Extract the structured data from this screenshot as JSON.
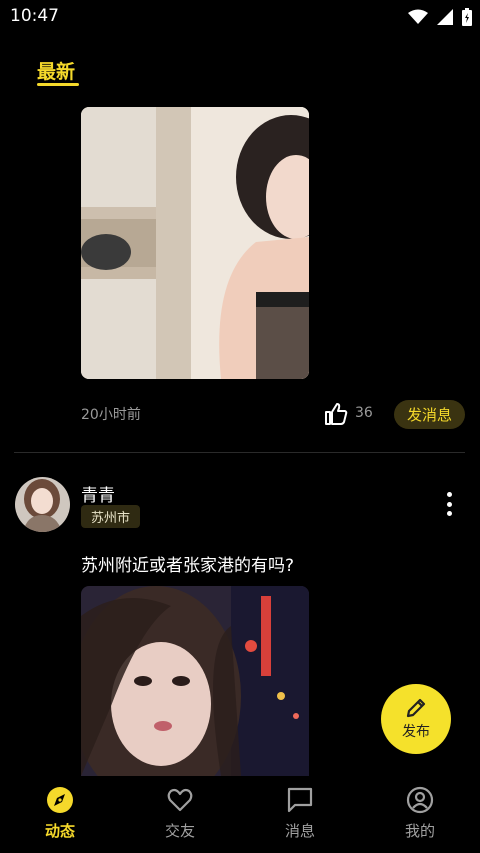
{
  "status_bar": {
    "time": "10:47"
  },
  "tabs": {
    "latest": "最新"
  },
  "post1": {
    "time_ago": "20小时前",
    "like_count": "36",
    "message_button": "发消息"
  },
  "post2": {
    "username": "青青",
    "location": "苏州市",
    "text": "苏州附近或者张家港的有吗?"
  },
  "fab": {
    "label": "发布"
  },
  "bottom_nav": {
    "items": [
      {
        "label": "动态",
        "icon": "compass-icon",
        "active": true
      },
      {
        "label": "交友",
        "icon": "heart-icon",
        "active": false
      },
      {
        "label": "消息",
        "icon": "message-icon",
        "active": false
      },
      {
        "label": "我的",
        "icon": "profile-icon",
        "active": false
      }
    ]
  },
  "colors": {
    "accent": "#F5D92B",
    "fab": "#F5E12B",
    "background": "#000000"
  }
}
